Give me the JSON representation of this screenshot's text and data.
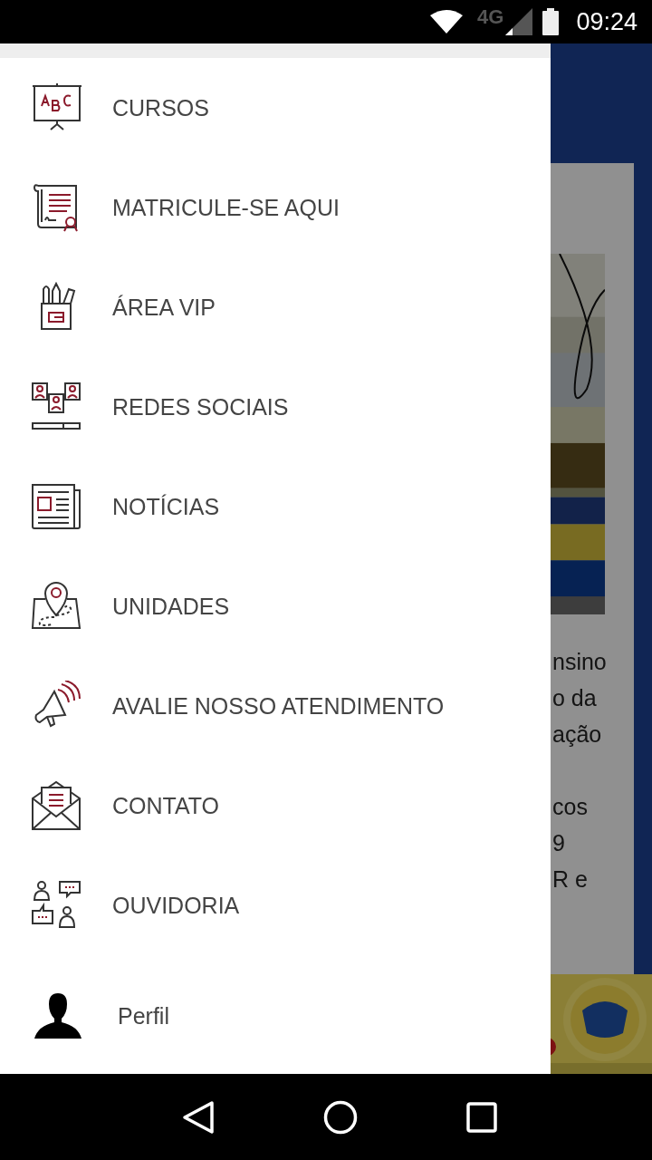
{
  "status_bar": {
    "network": "4G",
    "time": "09:24"
  },
  "menu": {
    "items": [
      {
        "label": "CURSOS"
      },
      {
        "label": "MATRICULE-SE AQUI"
      },
      {
        "label": "ÁREA VIP"
      },
      {
        "label": "REDES SOCIAIS"
      },
      {
        "label": "NOTÍCIAS"
      },
      {
        "label": "UNIDADES"
      },
      {
        "label": "AVALIE NOSSO ATENDIMENTO"
      },
      {
        "label": "CONTATO"
      },
      {
        "label": "OUVIDORIA"
      },
      {
        "label": "Perfil"
      }
    ]
  },
  "background": {
    "paragraph_1": [
      "nsino",
      "o da",
      "ação"
    ],
    "paragraph_2": [
      "cos",
      "9",
      "R e"
    ]
  }
}
